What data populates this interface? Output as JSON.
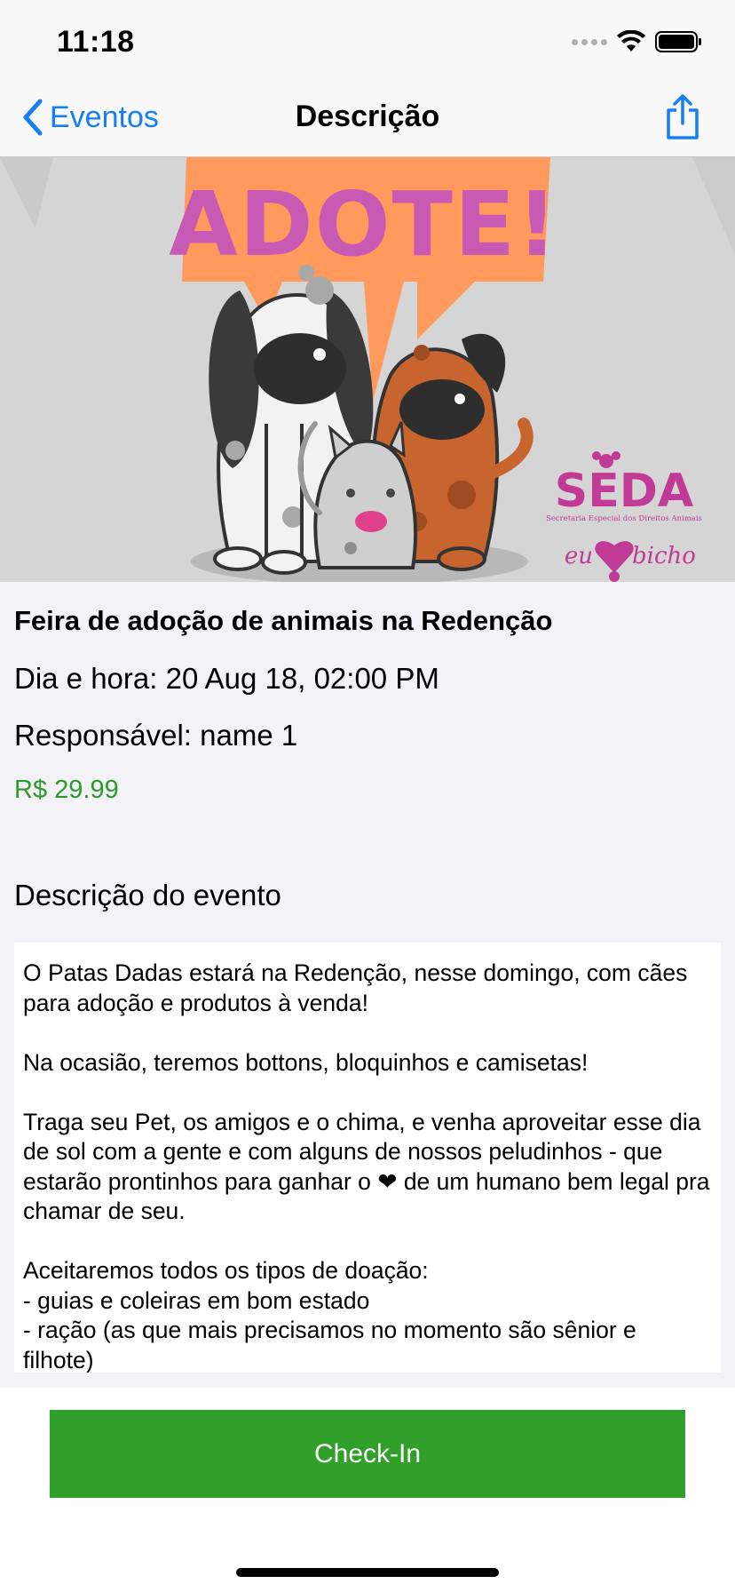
{
  "status_bar": {
    "time": "11:18"
  },
  "nav": {
    "back_label": "Eventos",
    "title": "Descrição"
  },
  "hero": {
    "logo_main": "SEDA",
    "logo_tagline": "Secretaria Especial dos Direitos Animais",
    "logo_second_left": "eu",
    "logo_second_right": "bicho"
  },
  "event": {
    "title": "Feira de adoção de animais na Redenção",
    "date_line": "Dia e hora: 20 Aug 18, 02:00 PM",
    "owner_line": "Responsável: name 1",
    "price": "R$ 29.99"
  },
  "description": {
    "heading": "Descrição do evento",
    "text": "O Patas Dadas estará na Redenção, nesse domingo, com cães para adoção e produtos à venda!\n\nNa ocasião, teremos bottons, bloquinhos e camisetas!\n\nTraga seu Pet, os amigos e o chima, e venha aproveitar esse dia de sol com a gente e com alguns de nossos peludinhos - que estarão prontinhos para ganhar o ❤︎ de um humano bem legal pra chamar de seu.\n\nAceitaremos todos os tipos de doação:\n- guias e coleiras em bom estado\n- ração (as que mais precisamos no momento são sênior e filhote)"
  },
  "actions": {
    "checkin_label": "Check-In"
  },
  "colors": {
    "accent": "#147EFB",
    "price": "#2E9A2B",
    "checkin_bg": "#30A02A",
    "poster_orange": "#FF9A5C",
    "poster_pink": "#C85AB4"
  }
}
